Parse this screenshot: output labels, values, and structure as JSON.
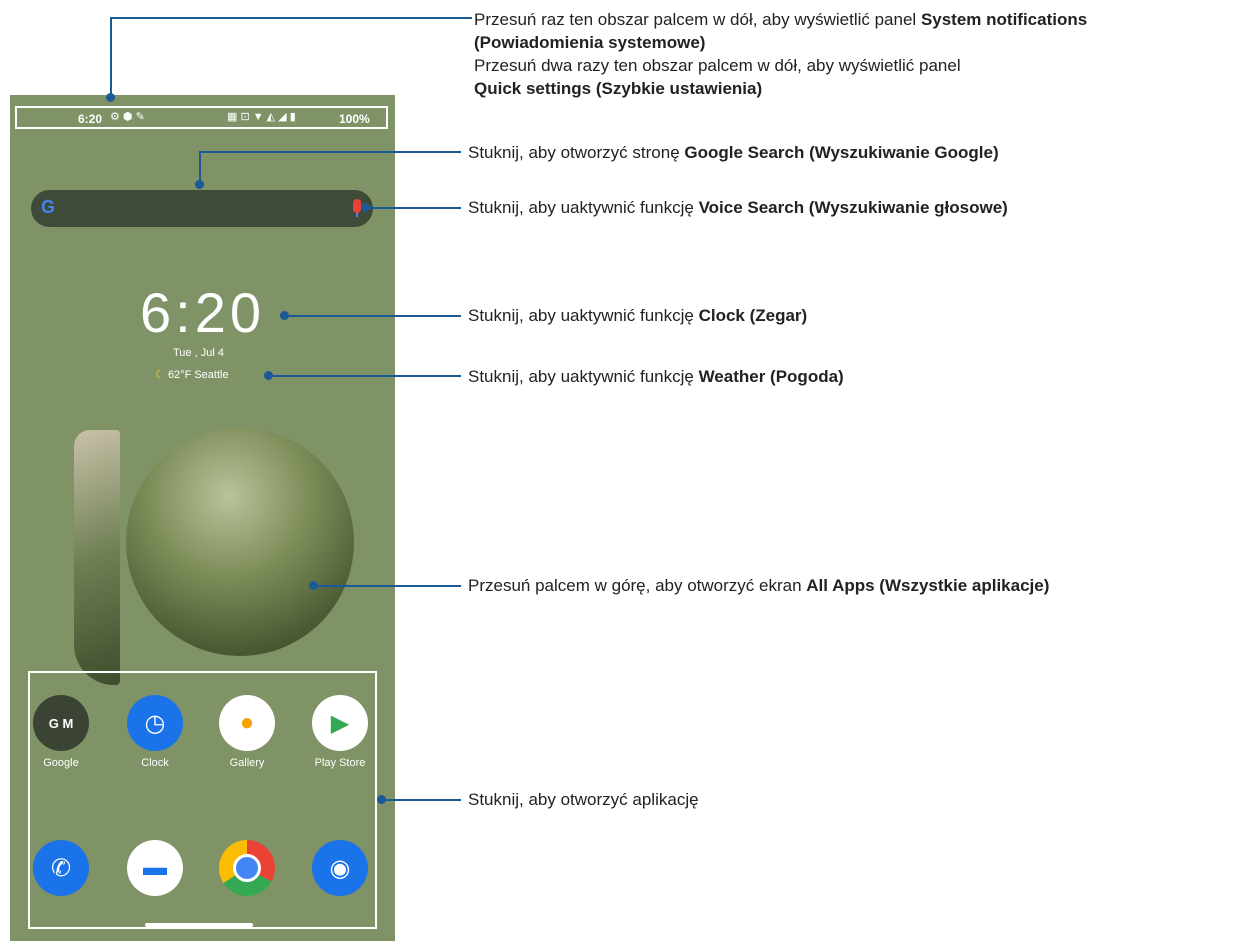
{
  "status_bar": {
    "time": "6:20",
    "battery": "100%"
  },
  "clock_widget": {
    "time": "6:20",
    "date": "Tue , Jul 4",
    "weather": "62°F  Seattle"
  },
  "apps": [
    {
      "label": "Google",
      "color": "#3b4334"
    },
    {
      "label": "Clock",
      "color": "#1a73e8"
    },
    {
      "label": "Gallery",
      "color": "#ffffff"
    },
    {
      "label": "Play Store",
      "color": "#ffffff"
    }
  ],
  "dock": [
    {
      "name": "phone",
      "color": "#1a73e8"
    },
    {
      "name": "messages",
      "color": "#ffffff"
    },
    {
      "name": "chrome",
      "color": "#ffffff"
    },
    {
      "name": "camera",
      "color": "#1a73e8"
    }
  ],
  "annotations": {
    "a1_pre": "Przesuń raz ten obszar palcem w dół, aby wyświetlić panel ",
    "a1_bold": "System notifications (Powiadomienia systemowe)",
    "a1b_pre": "Przesuń dwa razy ten obszar palcem w dół, aby wyświetlić panel ",
    "a1b_bold": "Quick settings (Szybkie ustawienia)",
    "a2_pre": "Stuknij, aby otworzyć stronę ",
    "a2_bold": "Google Search (Wyszukiwanie Google)",
    "a3_pre": "Stuknij, aby uaktywnić funkcję ",
    "a3_bold": "Voice Search (Wyszukiwanie głosowe)",
    "a4_pre": "Stuknij, aby uaktywnić funkcję ",
    "a4_bold": "Clock (Zegar)",
    "a5_pre": "Stuknij, aby uaktywnić funkcję ",
    "a5_bold": "Weather (Pogoda)",
    "a6_pre": "Przesuń palcem w górę, aby otworzyć ekran ",
    "a6_bold": "All Apps (Wszystkie aplikacje)",
    "a7": "Stuknij, aby otworzyć aplikację"
  }
}
